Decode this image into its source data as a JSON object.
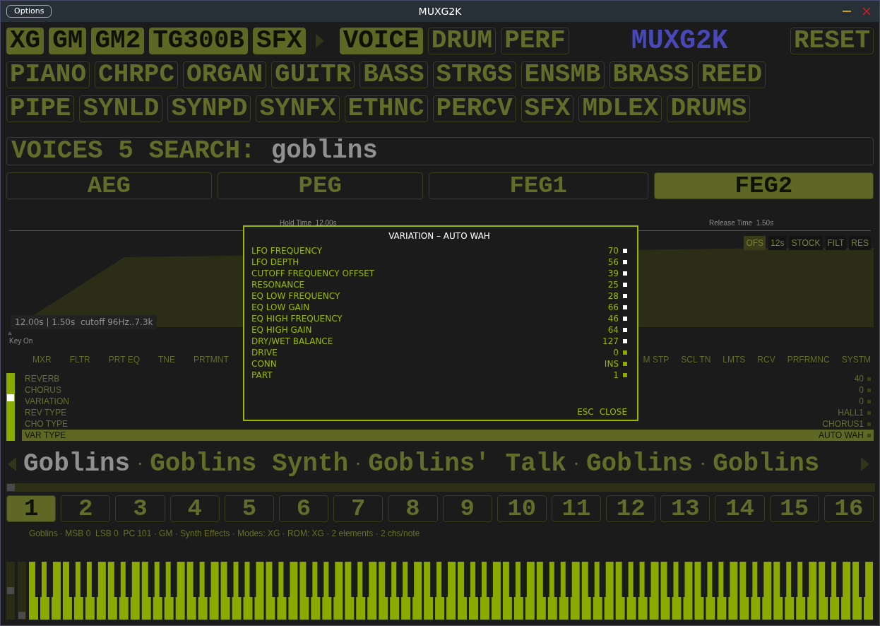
{
  "window": {
    "title": "MUXG2K",
    "options_button": "Options"
  },
  "modes": [
    {
      "label": "XG",
      "selected": true
    },
    {
      "label": "GM",
      "selected": true
    },
    {
      "label": "GM2",
      "selected": true
    },
    {
      "label": "TG300B",
      "selected": true
    },
    {
      "label": "SFX",
      "selected": true
    }
  ],
  "views": [
    {
      "label": "VOICE",
      "selected": true
    },
    {
      "label": "DRUM",
      "selected": false
    },
    {
      "label": "PERF",
      "selected": false
    }
  ],
  "logo": "MUXG2K",
  "reset_button": "RESET",
  "categories": [
    [
      {
        "label": "PIANO",
        "selected": false
      },
      {
        "label": "CHRPC",
        "selected": false
      },
      {
        "label": "ORGAN",
        "selected": false
      },
      {
        "label": "GUITR",
        "selected": false
      },
      {
        "label": "BASS",
        "selected": false
      },
      {
        "label": "STRGS",
        "selected": false
      },
      {
        "label": "ENSMB",
        "selected": false
      },
      {
        "label": "BRASS",
        "selected": false
      },
      {
        "label": "REED",
        "selected": false
      }
    ],
    [
      {
        "label": "PIPE",
        "selected": false
      },
      {
        "label": "SYNLD",
        "selected": false
      },
      {
        "label": "SYNPD",
        "selected": false
      },
      {
        "label": "SYNFX",
        "selected": false
      },
      {
        "label": "ETHNC",
        "selected": false
      },
      {
        "label": "PERCV",
        "selected": false
      },
      {
        "label": "SFX",
        "selected": false
      },
      {
        "label": "MDLEX",
        "selected": false
      },
      {
        "label": "DRUMS",
        "selected": false
      }
    ]
  ],
  "search": {
    "label": "VOICES 5 SEARCH:",
    "value": "goblins"
  },
  "envelope_tabs": [
    {
      "label": "AEG",
      "selected": false
    },
    {
      "label": "PEG",
      "selected": false
    },
    {
      "label": "FEG1",
      "selected": false
    },
    {
      "label": "FEG2",
      "selected": true
    }
  ],
  "envelope": {
    "hold_label": "Hold Time  12.00s",
    "release_label": "Release Time  1.50s",
    "summary": "12.00s | 1.50s  cutoff 96Hz..7.3k",
    "key_on_label": "Key On",
    "chips": [
      {
        "label": "OFS",
        "selected": true
      },
      {
        "label": "12s",
        "selected": false
      },
      {
        "label": "STOCK",
        "selected": false
      },
      {
        "label": "FILT",
        "selected": false
      },
      {
        "label": "RES",
        "selected": false
      }
    ]
  },
  "section_tabs_left": [
    {
      "label": "MXR",
      "selected": false
    },
    {
      "label": "FLTR",
      "selected": false
    },
    {
      "label": "PRT EQ",
      "selected": false
    },
    {
      "label": "TNE",
      "selected": false
    },
    {
      "label": "PRTMNT",
      "selected": false
    }
  ],
  "section_tabs_right": [
    {
      "label": "M STP",
      "selected": false
    },
    {
      "label": "SCL TN",
      "selected": false
    },
    {
      "label": "LMTS",
      "selected": false
    },
    {
      "label": "RCV",
      "selected": false
    },
    {
      "label": "PRFRMNC",
      "selected": false
    },
    {
      "label": "SYSTM",
      "selected": false
    }
  ],
  "params": [
    {
      "label": "REVERB",
      "value": "40",
      "selected": false
    },
    {
      "label": "CHORUS",
      "value": "0",
      "selected": false
    },
    {
      "label": "VARIATION",
      "value": "0",
      "selected": false
    },
    {
      "label": "REV TYPE",
      "value": "HALL1",
      "selected": false
    },
    {
      "label": "CHO TYPE",
      "value": "CHORUS1",
      "selected": false
    },
    {
      "label": "VAR TYPE",
      "value": "AUTO WAH",
      "selected": true
    }
  ],
  "voice_strip": [
    {
      "kind": "voice",
      "text": "Goblins",
      "selected": true
    },
    {
      "kind": "separator",
      "text": "·"
    },
    {
      "kind": "voice",
      "text": "Goblins Synth",
      "selected": false
    },
    {
      "kind": "separator",
      "text": "·"
    },
    {
      "kind": "voice",
      "text": "Goblins' Talk",
      "selected": false
    },
    {
      "kind": "separator",
      "text": "·"
    },
    {
      "kind": "voice",
      "text": "Goblins",
      "selected": false
    },
    {
      "kind": "separator",
      "text": "·"
    },
    {
      "kind": "voice",
      "text": "Goblins",
      "selected": false
    }
  ],
  "parts": [
    {
      "label": "1",
      "selected": true
    },
    {
      "label": "2",
      "selected": false
    },
    {
      "label": "3",
      "selected": false
    },
    {
      "label": "4",
      "selected": false
    },
    {
      "label": "5",
      "selected": false
    },
    {
      "label": "6",
      "selected": false
    },
    {
      "label": "7",
      "selected": false
    },
    {
      "label": "8",
      "selected": false
    },
    {
      "label": "9",
      "selected": false
    },
    {
      "label": "10",
      "selected": false
    },
    {
      "label": "11",
      "selected": false
    },
    {
      "label": "12",
      "selected": false
    },
    {
      "label": "13",
      "selected": false
    },
    {
      "label": "14",
      "selected": false
    },
    {
      "label": "15",
      "selected": false
    },
    {
      "label": "16",
      "selected": false
    }
  ],
  "info": "Goblins · MSB 0  LSB 0  PC 101 · GM · Synth Effects · Modes: XG · ROM: XG · 2 elements · 2 chs/note",
  "wheels": [
    {
      "level": 0.5
    },
    {
      "level": 0
    }
  ],
  "dialog": {
    "title": "VARIATION – AUTO WAH",
    "rows": [
      {
        "label": "LFO FREQUENCY",
        "value": "70",
        "color": "#ffffff"
      },
      {
        "label": "LFO DEPTH",
        "value": "56",
        "color": "#ffffff"
      },
      {
        "label": "CUTOFF FREQUENCY OFFSET",
        "value": "39",
        "color": "#ffffff"
      },
      {
        "label": "RESONANCE",
        "value": "25",
        "color": "#ffffff"
      },
      {
        "label": "EQ LOW FREQUENCY",
        "value": "28",
        "color": "#ffffff"
      },
      {
        "label": "EQ LOW GAIN",
        "value": "66",
        "color": "#ffffff"
      },
      {
        "label": "EQ HIGH FREQUENCY",
        "value": "46",
        "color": "#ffffff"
      },
      {
        "label": "EQ HIGH GAIN",
        "value": "64",
        "color": "#ffffff"
      },
      {
        "label": "DRY/WET BALANCE",
        "value": "127",
        "color": "#ffffff"
      },
      {
        "label": "DRIVE",
        "value": "0",
        "color": "#8aaa00"
      },
      {
        "label": "CONN",
        "value": "INS",
        "color": "#8aaa00"
      },
      {
        "label": "PART",
        "value": "1",
        "color": "#8aaa00"
      }
    ],
    "footer": [
      "ESC",
      "CLOSE"
    ]
  }
}
